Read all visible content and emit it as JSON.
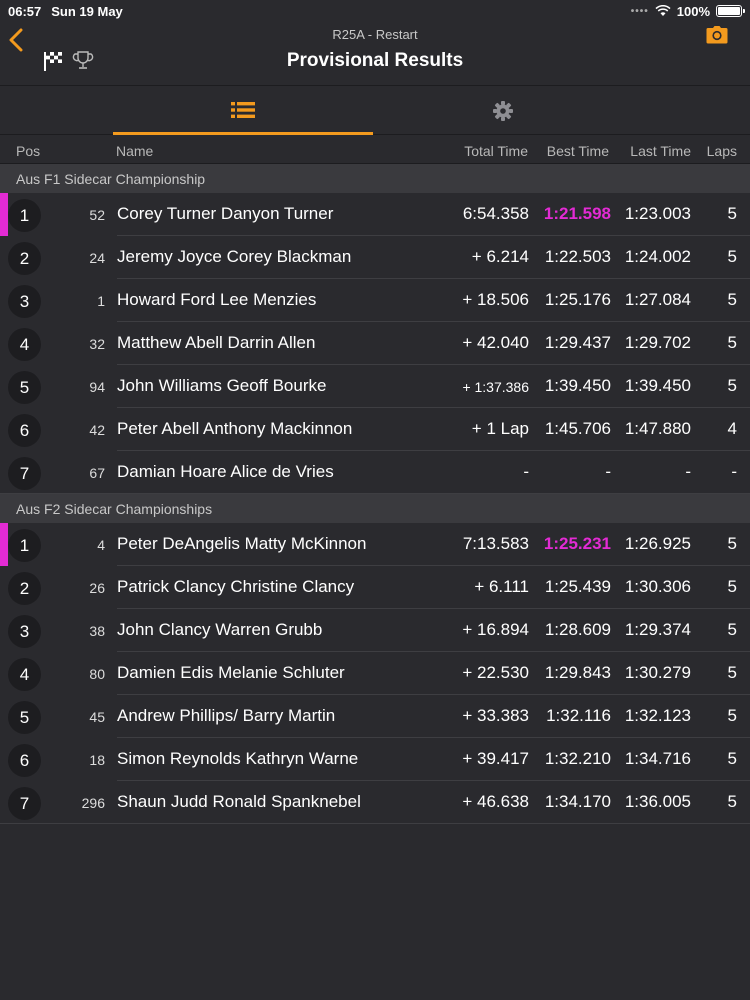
{
  "status_bar": {
    "time": "06:57",
    "date": "Sun 19 May",
    "battery": "100%"
  },
  "header": {
    "race": "R25A  - Restart",
    "title": "Provisional Results"
  },
  "columns": {
    "pos": "Pos",
    "name": "Name",
    "total": "Total Time",
    "best": "Best Time",
    "last": "Last Time",
    "laps": "Laps"
  },
  "colors": {
    "accent": "#f39a1e",
    "fastest": "#e32bd4",
    "background": "#2a2a2e"
  },
  "sections": [
    {
      "title": "Aus F1 Sidecar Championship",
      "rows": [
        {
          "pos": "1",
          "num": "52",
          "name": "Corey Turner Danyon Turner",
          "total": "6:54.358",
          "best": "1:21.598",
          "last": "1:23.003",
          "laps": "5",
          "fastest": true,
          "leader": true
        },
        {
          "pos": "2",
          "num": "24",
          "name": "Jeremy Joyce Corey Blackman",
          "total": "+ 6.214",
          "best": "1:22.503",
          "last": "1:24.002",
          "laps": "5"
        },
        {
          "pos": "3",
          "num": "1",
          "name": "Howard Ford Lee Menzies",
          "total": "+ 18.506",
          "best": "1:25.176",
          "last": "1:27.084",
          "laps": "5"
        },
        {
          "pos": "4",
          "num": "32",
          "name": "Matthew Abell Darrin Allen",
          "total": "+ 42.040",
          "best": "1:29.437",
          "last": "1:29.702",
          "laps": "5"
        },
        {
          "pos": "5",
          "num": "94",
          "name": "John Williams Geoff Bourke",
          "total": "+ 1:37.386",
          "best": "1:39.450",
          "last": "1:39.450",
          "laps": "5",
          "small_total": true
        },
        {
          "pos": "6",
          "num": "42",
          "name": "Peter Abell Anthony Mackinnon",
          "total": "+ 1 Lap",
          "best": "1:45.706",
          "last": "1:47.880",
          "laps": "4"
        },
        {
          "pos": "7",
          "num": "67",
          "name": "Damian Hoare Alice de Vries",
          "total": "-",
          "best": "-",
          "last": "-",
          "laps": "-"
        }
      ]
    },
    {
      "title": "Aus F2 Sidecar Championships",
      "rows": [
        {
          "pos": "1",
          "num": "4",
          "name": "Peter DeAngelis Matty McKinnon",
          "total": "7:13.583",
          "best": "1:25.231",
          "last": "1:26.925",
          "laps": "5",
          "fastest": true,
          "leader": true
        },
        {
          "pos": "2",
          "num": "26",
          "name": "Patrick Clancy Christine Clancy",
          "total": "+ 6.111",
          "best": "1:25.439",
          "last": "1:30.306",
          "laps": "5"
        },
        {
          "pos": "3",
          "num": "38",
          "name": "John Clancy Warren Grubb",
          "total": "+ 16.894",
          "best": "1:28.609",
          "last": "1:29.374",
          "laps": "5"
        },
        {
          "pos": "4",
          "num": "80",
          "name": "Damien Edis Melanie Schluter",
          "total": "+ 22.530",
          "best": "1:29.843",
          "last": "1:30.279",
          "laps": "5"
        },
        {
          "pos": "5",
          "num": "45",
          "name": "Andrew Phillips/ Barry Martin",
          "total": "+ 33.383",
          "best": "1:32.116",
          "last": "1:32.123",
          "laps": "5"
        },
        {
          "pos": "6",
          "num": "18",
          "name": "Simon Reynolds Kathryn Warne",
          "total": "+ 39.417",
          "best": "1:32.210",
          "last": "1:34.716",
          "laps": "5"
        },
        {
          "pos": "7",
          "num": "296",
          "name": "Shaun Judd Ronald Spanknebel",
          "total": "+ 46.638",
          "best": "1:34.170",
          "last": "1:36.005",
          "laps": "5"
        }
      ]
    }
  ]
}
